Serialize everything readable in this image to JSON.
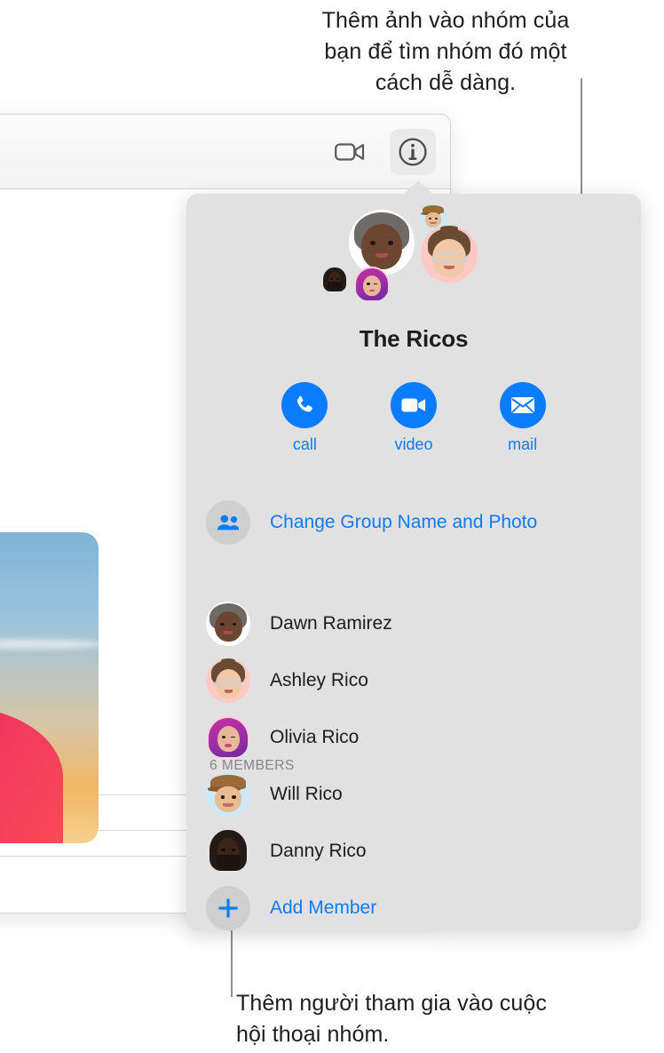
{
  "callouts": {
    "top": "Thêm ảnh vào nhóm của bạn để tìm nhóm đó một cách dễ dàng.",
    "bottom": "Thêm người tham gia vào cuộc hội thoại nhóm."
  },
  "toolbar": {
    "video_icon": "video-camera-icon",
    "info_icon": "info-circle-icon"
  },
  "popover": {
    "group_title": "The Ricos",
    "actions": [
      {
        "label": "call",
        "icon": "phone-icon"
      },
      {
        "label": "video",
        "icon": "video-camera-icon"
      },
      {
        "label": "mail",
        "icon": "envelope-icon"
      }
    ],
    "change_group": {
      "label": "Change Group Name and Photo",
      "icon": "two-people-icon"
    },
    "members_header": "6 MEMBERS",
    "members": [
      {
        "name": "Dawn Ramirez",
        "avatar": "memoji-dawn"
      },
      {
        "name": "Ashley Rico",
        "avatar": "memoji-ashley"
      },
      {
        "name": "Olivia Rico",
        "avatar": "memoji-olivia"
      },
      {
        "name": "Will Rico",
        "avatar": "memoji-will"
      },
      {
        "name": "Danny Rico",
        "avatar": "memoji-danny"
      }
    ],
    "add_member": {
      "label": "Add Member",
      "icon": "plus-icon"
    }
  },
  "colors": {
    "accent_blue": "#0a7cff",
    "popover_background": "#e1e1e1",
    "secondary_text": "#86868b",
    "primary_text": "#1d1d1f",
    "leader_line": "#8e8e8e"
  }
}
